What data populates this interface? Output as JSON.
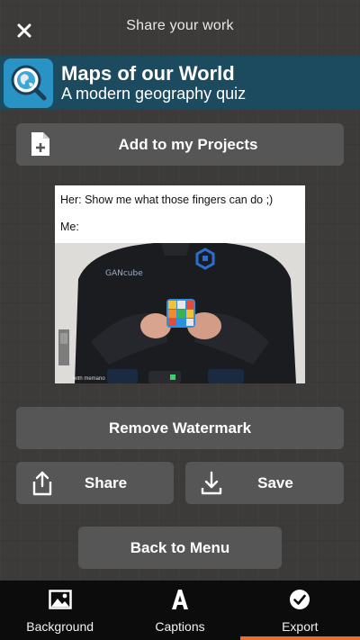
{
  "header": {
    "title": "Share your work"
  },
  "banner": {
    "title": "Maps of our World",
    "subtitle": "A modern geography quiz",
    "logo_icon": "globe-search-icon",
    "color": "#1c4b5f"
  },
  "actions": {
    "add_label": "Add to my Projects",
    "remove_watermark_label": "Remove Watermark",
    "share_label": "Share",
    "save_label": "Save",
    "back_label": "Back to Menu"
  },
  "meme": {
    "line1": "Her: Show me what those fingers can do ;)",
    "line2": "Me:",
    "shirt_text": "GANcube",
    "watermark": "with memario"
  },
  "bottom_nav": {
    "items": [
      {
        "label": "Background",
        "icon": "image-icon"
      },
      {
        "label": "Captions",
        "icon": "text-a-icon"
      },
      {
        "label": "Export",
        "icon": "check-circle-icon",
        "active": true
      }
    ],
    "accent": "#e8702a"
  }
}
